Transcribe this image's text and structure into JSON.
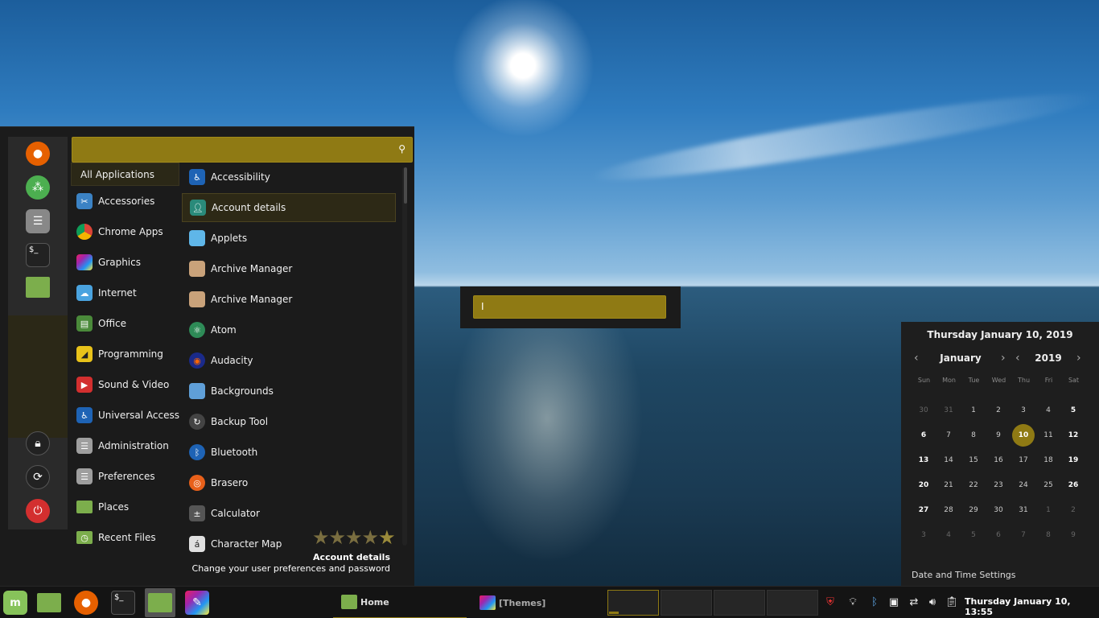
{
  "menu": {
    "favorites": [
      {
        "icon": "firefox-icon",
        "color": "#e66000"
      },
      {
        "icon": "software-manager-icon",
        "color": "#4caf50"
      },
      {
        "icon": "settings-icon",
        "color": "#888888"
      },
      {
        "icon": "terminal-icon",
        "glyph": "$_",
        "color": "#222222"
      },
      {
        "icon": "files-icon",
        "color": "#7cae4c"
      }
    ],
    "session": [
      {
        "icon": "lock-icon",
        "color": "#222222"
      },
      {
        "icon": "logout-icon",
        "color": "#222222"
      },
      {
        "icon": "power-icon",
        "color": "#d32f2f"
      }
    ],
    "categories": [
      {
        "label": "All Applications"
      },
      {
        "label": "Accessories",
        "icon": "accessories-icon",
        "color": "#3b82c4"
      },
      {
        "label": "Chrome Apps",
        "icon": "chrome-icon",
        "color": "#db4437"
      },
      {
        "label": "Graphics",
        "icon": "graphics-icon",
        "color": "#9c27b0"
      },
      {
        "label": "Internet",
        "icon": "internet-icon",
        "color": "#4aa3df"
      },
      {
        "label": "Office",
        "icon": "office-icon",
        "color": "#4a8a3a"
      },
      {
        "label": "Programming",
        "icon": "programming-icon",
        "color": "#e8c21a"
      },
      {
        "label": "Sound & Video",
        "icon": "sound-video-icon",
        "color": "#d32f2f"
      },
      {
        "label": "Universal Access",
        "icon": "universal-access-icon",
        "color": "#1e63b5"
      },
      {
        "label": "Administration",
        "icon": "administration-icon",
        "color": "#9e9e9e"
      },
      {
        "label": "Preferences",
        "icon": "preferences-icon",
        "color": "#9e9e9e"
      },
      {
        "label": "Places",
        "icon": "places-icon",
        "color": "#7cae4c"
      },
      {
        "label": "Recent Files",
        "icon": "recent-files-icon",
        "color": "#7cae4c"
      }
    ],
    "apps": [
      {
        "label": "Accessibility",
        "icon": "accessibility-icon",
        "color": "#1e63b5"
      },
      {
        "label": "Account details",
        "icon": "account-details-icon",
        "color": "#2a8a7a"
      },
      {
        "label": "Applets",
        "icon": "applets-icon",
        "color": "#5fb6e8"
      },
      {
        "label": "Archive Manager",
        "icon": "archive-manager-icon",
        "color": "#c9a27a"
      },
      {
        "label": "Archive Manager",
        "icon": "archive-manager-icon",
        "color": "#c9a27a"
      },
      {
        "label": "Atom",
        "icon": "atom-icon",
        "color": "#2e8b57"
      },
      {
        "label": "Audacity",
        "icon": "audacity-icon",
        "color": "#1a2a8a"
      },
      {
        "label": "Backgrounds",
        "icon": "backgrounds-icon",
        "color": "#5f9fd8"
      },
      {
        "label": "Backup Tool",
        "icon": "backup-tool-icon",
        "color": "#444444"
      },
      {
        "label": "Bluetooth",
        "icon": "bluetooth-icon",
        "color": "#1e63b5"
      },
      {
        "label": "Brasero",
        "icon": "brasero-icon",
        "color": "#e8601a"
      },
      {
        "label": "Calculator",
        "icon": "calculator-icon",
        "color": "#555555"
      },
      {
        "label": "Character Map",
        "icon": "character-map-icon",
        "color": "#e0e0e0"
      }
    ],
    "selected_app": "Account details",
    "rating": 5,
    "description_title": "Account details",
    "description_text": "Change your user preferences and password"
  },
  "popup": {
    "value": "I"
  },
  "calendar": {
    "header": "Thursday January 10, 2019",
    "month": "January",
    "year": "2019",
    "weekdays": [
      "Sun",
      "Mon",
      "Tue",
      "Wed",
      "Thu",
      "Fri",
      "Sat"
    ],
    "weeks": [
      [
        "30",
        "31",
        "1",
        "2",
        "3",
        "4",
        "5"
      ],
      [
        "6",
        "7",
        "8",
        "9",
        "10",
        "11",
        "12"
      ],
      [
        "13",
        "14",
        "15",
        "16",
        "17",
        "18",
        "19"
      ],
      [
        "20",
        "21",
        "22",
        "23",
        "24",
        "25",
        "26"
      ],
      [
        "27",
        "28",
        "29",
        "30",
        "31",
        "1",
        "2"
      ],
      [
        "3",
        "4",
        "5",
        "6",
        "7",
        "8",
        "9"
      ]
    ],
    "today": "10",
    "footer": "Date and Time Settings"
  },
  "taskbar": {
    "launchers": [
      {
        "icon": "mint-menu-icon",
        "color": "#87c35a"
      },
      {
        "icon": "files-icon",
        "color": "#7cae4c"
      },
      {
        "icon": "firefox-icon",
        "color": "#e66000"
      },
      {
        "icon": "terminal-icon",
        "glyph": "$_",
        "color": "#222222"
      },
      {
        "icon": "files-icon",
        "color": "#7cae4c"
      },
      {
        "icon": "themes-icon",
        "color": "#9c27b0"
      }
    ],
    "windows": [
      {
        "label": "Home",
        "icon": "folder-icon",
        "color": "#7cae4c",
        "active": true
      },
      {
        "label": "[Themes]",
        "icon": "themes-icon",
        "color": "#9c27b0",
        "active": false
      }
    ],
    "workspaces": 4,
    "tray": [
      "shield-icon",
      "redshift-icon",
      "bluetooth-icon",
      "update-icon",
      "network-icon",
      "volume-icon",
      "clipboard-icon"
    ],
    "clock": "Thursday January 10, 13:55"
  }
}
